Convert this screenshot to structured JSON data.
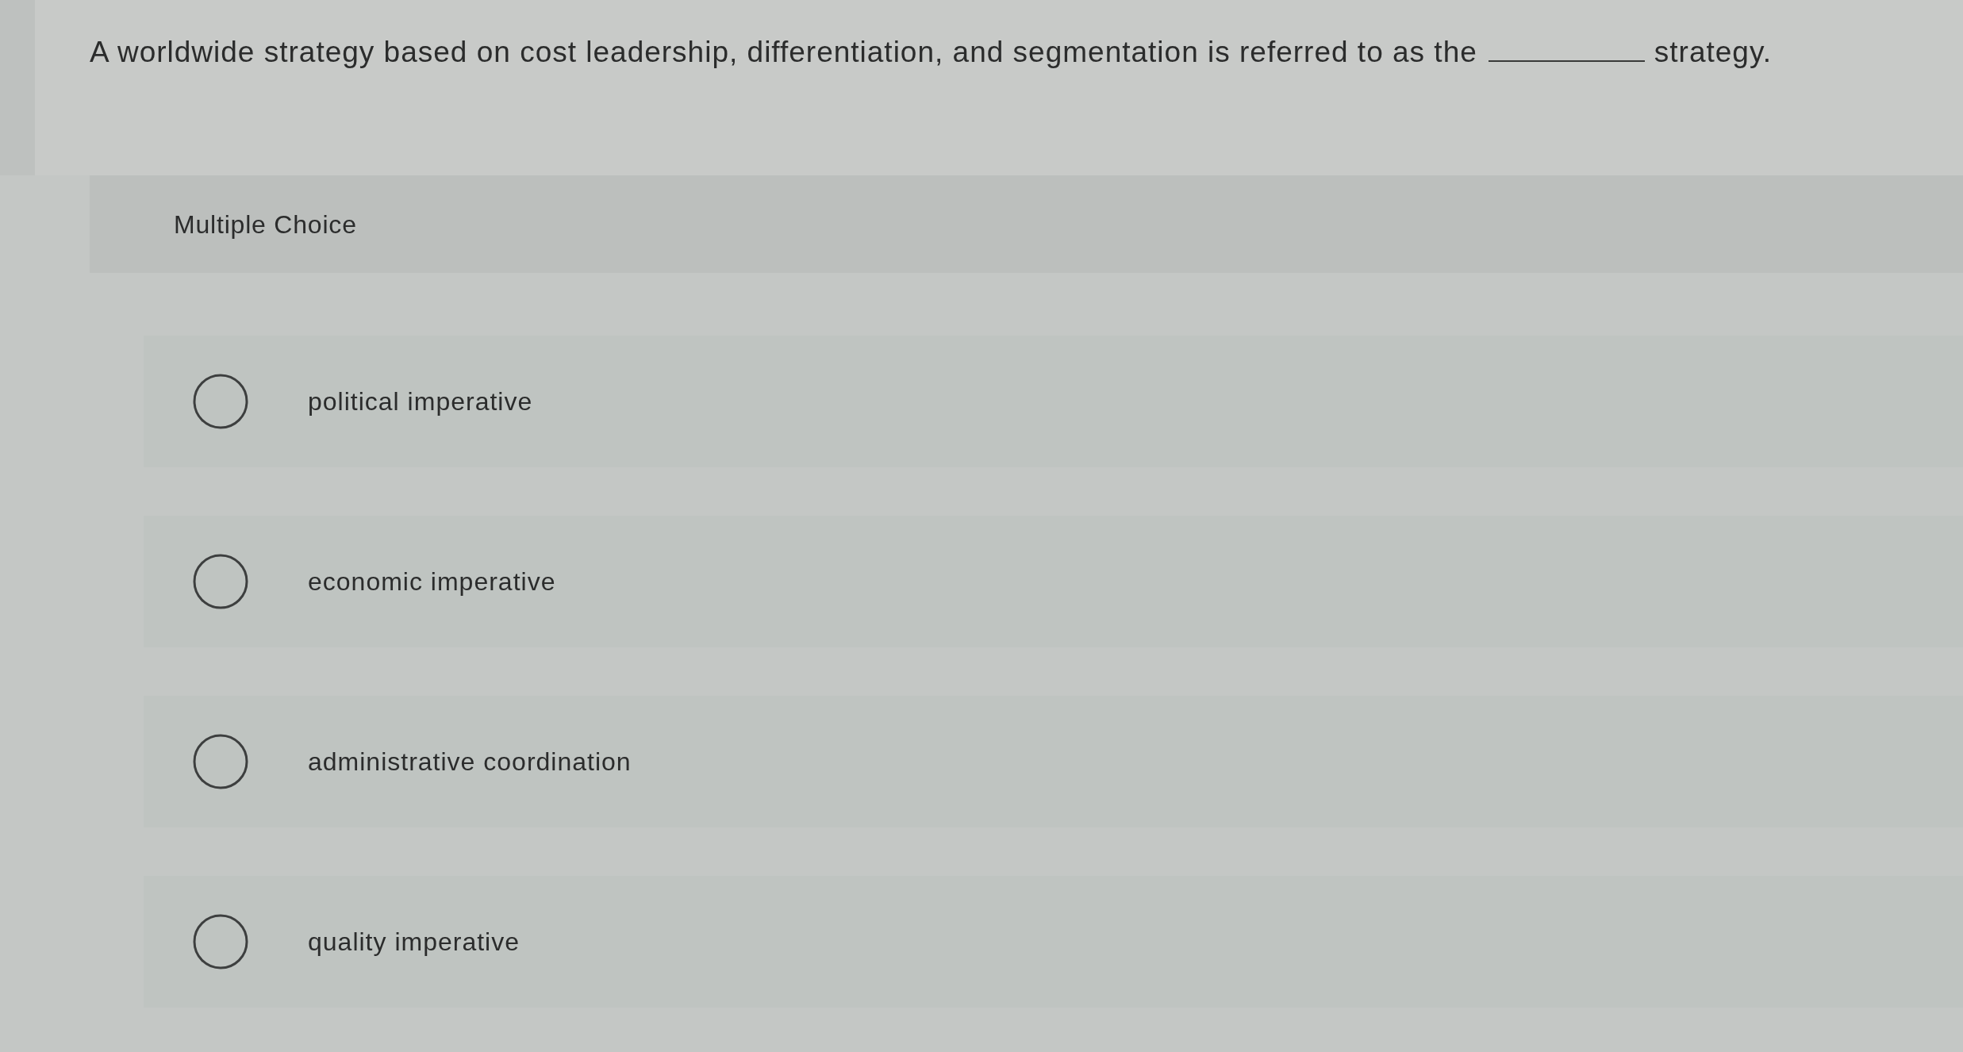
{
  "question": {
    "text_before": "A worldwide strategy based on cost leadership, differentiation, and segmentation is referred to as the",
    "text_after": "strategy."
  },
  "question_type": "Multiple Choice",
  "options": [
    {
      "label": "political imperative",
      "selected": false
    },
    {
      "label": "economic imperative",
      "selected": false
    },
    {
      "label": "administrative coordination",
      "selected": false
    },
    {
      "label": "quality imperative",
      "selected": false
    }
  ]
}
